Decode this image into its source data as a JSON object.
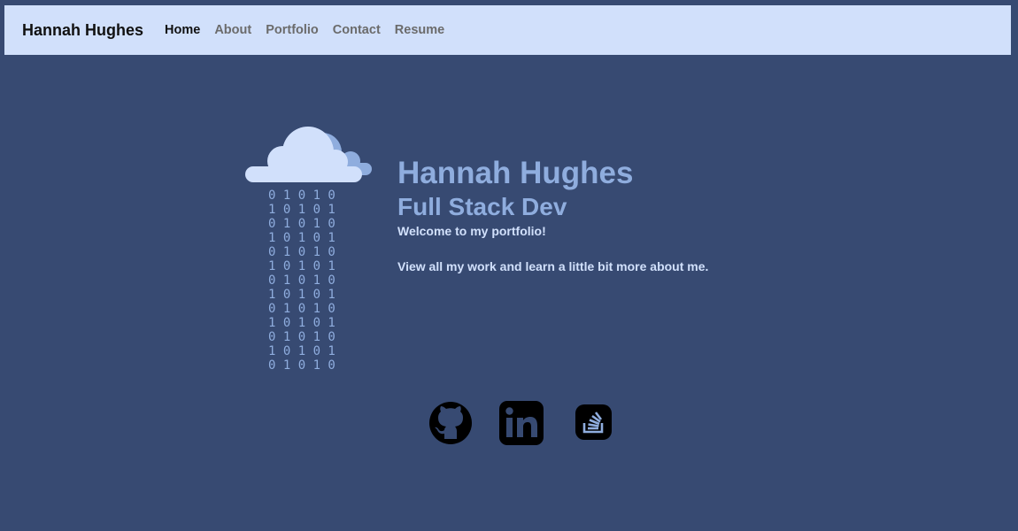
{
  "navbar": {
    "brand": "Hannah Hughes",
    "links": [
      {
        "label": "Home",
        "active": true
      },
      {
        "label": "About",
        "active": false
      },
      {
        "label": "Portfolio",
        "active": false
      },
      {
        "label": "Contact",
        "active": false
      },
      {
        "label": "Resume",
        "active": false
      }
    ]
  },
  "hero": {
    "name": "Hannah Hughes",
    "role": "Full Stack Dev",
    "welcome": "Welcome to my portfolio!",
    "description": "View all my work and learn a little bit more about me.",
    "graphic": {
      "icon": "cloud-icon",
      "rain_rows": [
        "0 1 0 1 0",
        "1 0 1 0 1"
      ]
    }
  },
  "socials": [
    {
      "icon": "github-icon"
    },
    {
      "icon": "linkedin-icon"
    },
    {
      "icon": "stackoverflow-icon"
    }
  ],
  "colors": {
    "background": "#374a72",
    "navbar": "#d1e0fb",
    "accent": "#8fadde",
    "text_light": "#d1e0fb"
  }
}
